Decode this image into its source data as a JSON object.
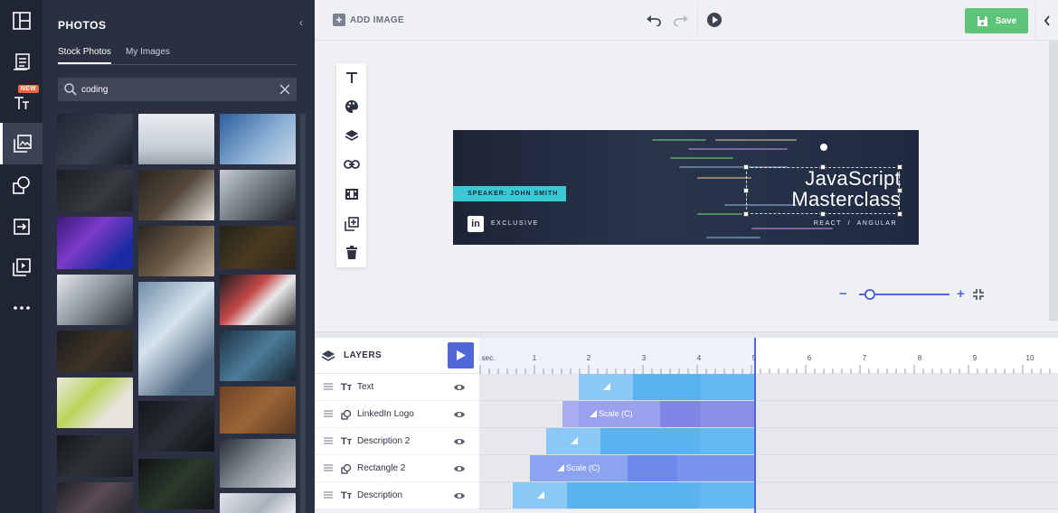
{
  "rail": {
    "items": [
      {
        "name": "layout-icon"
      },
      {
        "name": "text-list-icon"
      },
      {
        "name": "text-new-icon",
        "badge": "NEW"
      },
      {
        "name": "photos-icon"
      },
      {
        "name": "shapes-icon"
      },
      {
        "name": "import-icon"
      },
      {
        "name": "video-icon"
      },
      {
        "name": "more-icon"
      }
    ]
  },
  "panel": {
    "title": "PHOTOS",
    "tabs": [
      "Stock Photos",
      "My Images"
    ],
    "search": {
      "value": "coding",
      "placeholder": "Search"
    }
  },
  "topbar": {
    "add_image": "ADD IMAGE",
    "save": "Save"
  },
  "banner": {
    "speaker": "SPEAKER: JOHN SMITH",
    "linkedin": "in",
    "exclusive": "EXCLUSIVE",
    "title_line1": "JavaScript",
    "title_line2": "Masterclass",
    "tags": "REACT  /  ANGULAR"
  },
  "timeline": {
    "title": "LAYERS",
    "ruler_unit": "sec.",
    "ticks": [
      "1",
      "2",
      "3",
      "4",
      "5",
      "6",
      "7",
      "8",
      "9",
      "10"
    ],
    "layers": [
      {
        "name": "Text",
        "type": "text",
        "bar_label": ""
      },
      {
        "name": "LinkedIn Logo",
        "type": "shape",
        "bar_label": "Scale (C)"
      },
      {
        "name": "Description 2",
        "type": "text",
        "bar_label": ""
      },
      {
        "name": "Rectangle 2",
        "type": "shape",
        "bar_label": "Scale (C)"
      },
      {
        "name": "Description",
        "type": "text",
        "bar_label": ""
      }
    ]
  },
  "colors": {
    "rail_bg": "#1f2533",
    "panel_bg": "#2a3041",
    "accent": "#4f67d8",
    "save": "#5ec47a",
    "speaker_bg": "#3bc8d6",
    "bar_blue": "#5ab3f0",
    "bar_purple": "#8a8ee8"
  }
}
